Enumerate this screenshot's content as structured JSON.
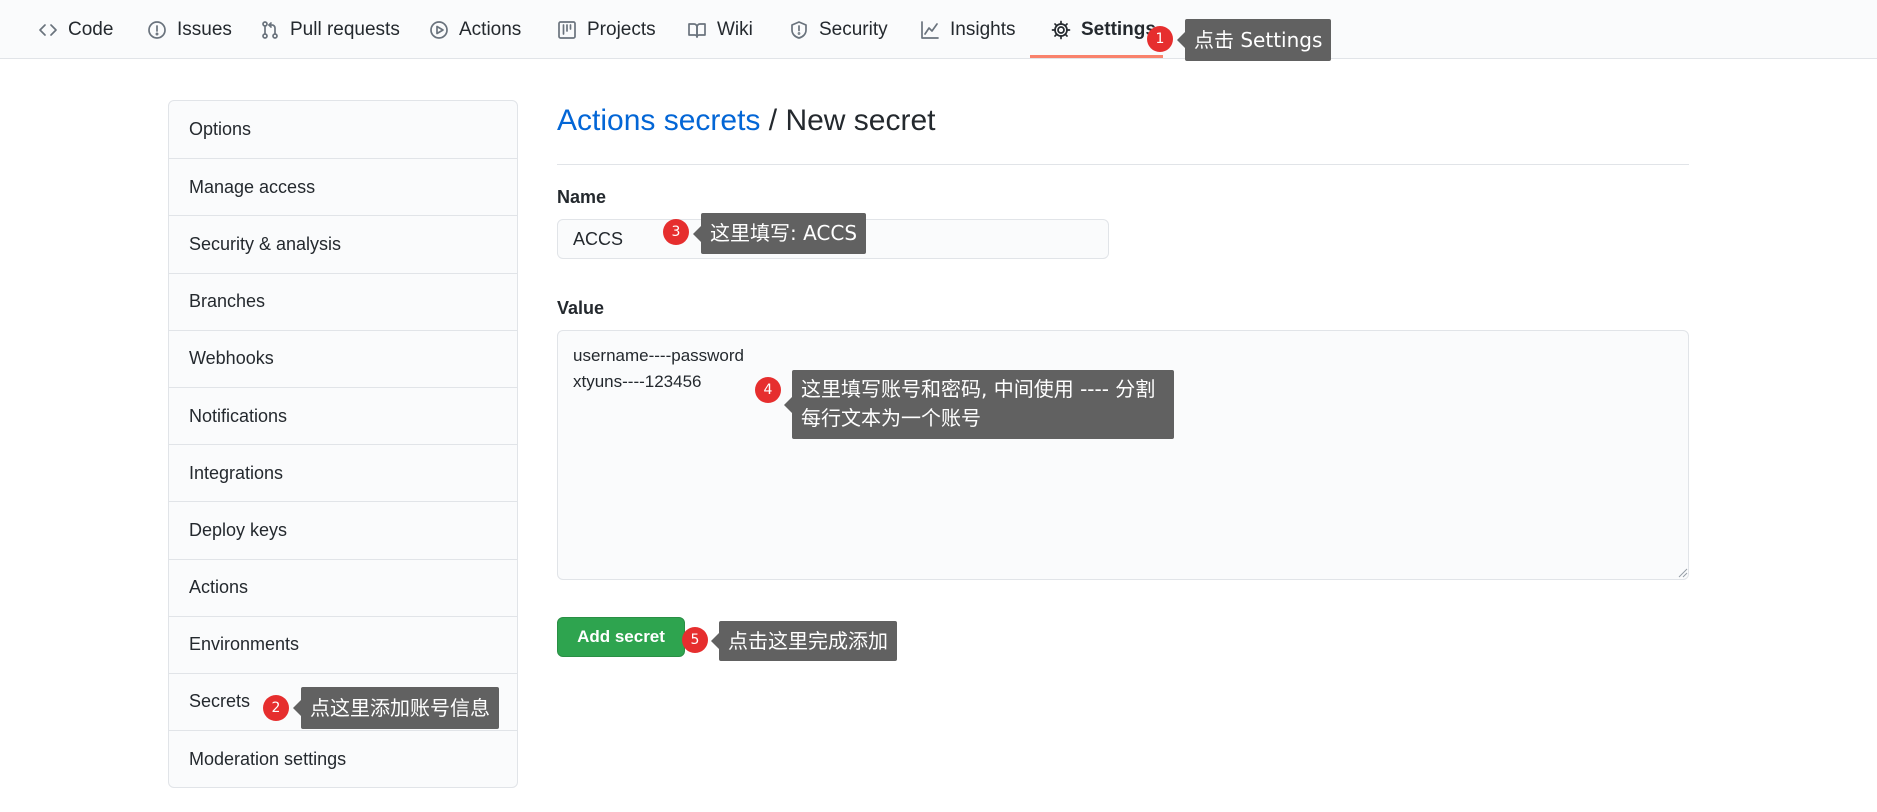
{
  "tabs": [
    {
      "label": "Code",
      "icon": "code-icon"
    },
    {
      "label": "Issues",
      "icon": "issue-opened-icon"
    },
    {
      "label": "Pull requests",
      "icon": "git-pull-request-icon"
    },
    {
      "label": "Actions",
      "icon": "play-icon"
    },
    {
      "label": "Projects",
      "icon": "project-icon"
    },
    {
      "label": "Wiki",
      "icon": "book-icon"
    },
    {
      "label": "Security",
      "icon": "shield-icon"
    },
    {
      "label": "Insights",
      "icon": "graph-icon"
    },
    {
      "label": "Settings",
      "icon": "gear-icon",
      "selected": true
    }
  ],
  "sidebar": {
    "items": [
      {
        "label": "Options"
      },
      {
        "label": "Manage access"
      },
      {
        "label": "Security & analysis"
      },
      {
        "label": "Branches"
      },
      {
        "label": "Webhooks"
      },
      {
        "label": "Notifications"
      },
      {
        "label": "Integrations"
      },
      {
        "label": "Deploy keys"
      },
      {
        "label": "Actions"
      },
      {
        "label": "Environments"
      },
      {
        "label": "Secrets"
      },
      {
        "label": "Moderation settings"
      }
    ]
  },
  "main": {
    "breadcrumb_link": "Actions secrets",
    "breadcrumb_separator": " / ",
    "breadcrumb_current": "New secret",
    "name_label": "Name",
    "name_value": "ACCS",
    "value_label": "Value",
    "value_text": "username----password\nxtyuns----123456",
    "submit_label": "Add secret"
  },
  "annotations": [
    {
      "number": "1",
      "text": "点击 Settings"
    },
    {
      "number": "2",
      "text": "点这里添加账号信息"
    },
    {
      "number": "3",
      "text": "这里填写: ACCS"
    },
    {
      "number": "4",
      "line1": "这里填写账号和密码, 中间使用 ---- 分割",
      "line2": "每行文本为一个账号"
    },
    {
      "number": "5",
      "text": "点击这里完成添加"
    }
  ],
  "colors": {
    "accent_link": "#0366d6",
    "tab_underline": "#f9826c",
    "primary_button": "#2ea44f",
    "annotation_badge": "#e62e2e",
    "annotation_callout": "#616161"
  }
}
